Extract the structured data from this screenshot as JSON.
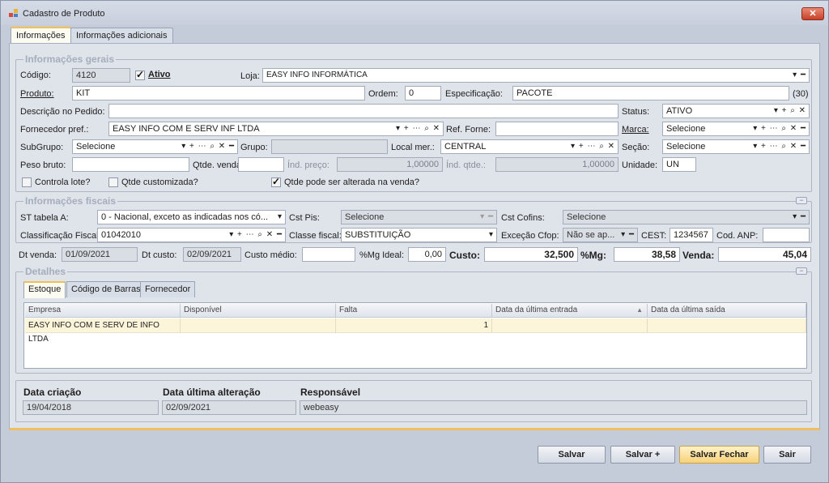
{
  "window": {
    "title": "Cadastro de Produto",
    "close": "✕"
  },
  "tabs": [
    "Informações",
    "Informações adicionais"
  ],
  "gerais": {
    "title": "Informações gerais",
    "codigo_label": "Código:",
    "codigo": "4120",
    "ativo_label": "Ativo",
    "loja_label": "Loja:",
    "loja": "EASY INFO INFORMÁTICA",
    "produto_label": "Produto:",
    "produto": "KIT",
    "ordem_label": "Ordem:",
    "ordem": "0",
    "especificacao_label": "Especificação:",
    "especificacao": "PACOTE",
    "especificacao_count": "(30)",
    "descricao_label": "Descrição no Pedido:",
    "descricao": "",
    "status_label": "Status:",
    "status": "ATIVO",
    "fornecedor_label": "Fornecedor pref.:",
    "fornecedor": "EASY INFO COM E SERV INF LTDA",
    "ref_forne_label": "Ref. Forne:",
    "ref_forne": "",
    "marca_label": "Marca:",
    "marca": "Selecione",
    "subgrupo_label": "SubGrupo:",
    "subgrupo": "Selecione",
    "grupo_label": "Grupo:",
    "grupo": "",
    "local_label": "Local mer.:",
    "local": "CENTRAL",
    "secao_label": "Seção:",
    "secao": "Selecione",
    "peso_label": "Peso bruto:",
    "peso": "",
    "qtde_venda_label": "Qtde. venda:",
    "qtde_venda": "",
    "ind_preco_label": "Índ. preço:",
    "ind_preco": "1,00000",
    "ind_qtde_label": "Índ. qtde.:",
    "ind_qtde": "1,00000",
    "unidade_label": "Unidade:",
    "unidade": "UN",
    "controla_lote": "Controla lote?",
    "qtde_customizada": "Qtde customizada?",
    "qtde_alterada": "Qtde pode ser alterada na venda?"
  },
  "fiscais": {
    "title": "Informações fiscais",
    "st_label": "ST tabela A:",
    "st": "0 - Nacional, exceto as indicadas nos có...",
    "cst_pis_label": "Cst Pis:",
    "cst_pis": "Selecione",
    "cst_cofins_label": "Cst Cofins:",
    "cst_cofins": "Selecione",
    "classif_label": "Classificação Fiscal:",
    "classif": "01042010",
    "classe_label": "Classe fiscal:",
    "classe": "SUBSTITUIÇÃO",
    "excecao_label": "Exceção Cfop:",
    "excecao": "Não se ap...",
    "cest_label": "CEST:",
    "cest": "1234567",
    "cod_anp_label": "Cod. ANP:",
    "cod_anp": ""
  },
  "precos": {
    "dt_venda_label": "Dt venda:",
    "dt_venda": "01/09/2021",
    "dt_custo_label": "Dt custo:",
    "dt_custo": "02/09/2021",
    "custo_medio_label": "Custo médio:",
    "custo_medio": "",
    "mg_ideal_label": "%Mg Ideal:",
    "mg_ideal": "0,00",
    "custo_label": "Custo:",
    "custo": "32,500",
    "mg_label": "%Mg:",
    "mg": "38,58",
    "venda_label": "Venda:",
    "venda": "45,04"
  },
  "detalhes": {
    "title": "Detalhes",
    "subtabs": [
      "Estoque",
      "Código de Barras",
      "Fornecedor"
    ],
    "columns": [
      "Empresa",
      "Disponível",
      "Falta",
      "Data da última entrada",
      "Data da última saída"
    ],
    "rows": [
      [
        "EASY INFO COM E SERV DE INFO LTDA",
        "",
        "1",
        "",
        ""
      ]
    ]
  },
  "footer": {
    "data_criacao_label": "Data criação",
    "data_criacao": "19/04/2018",
    "data_alteracao_label": "Data última alteração",
    "data_alteracao": "02/09/2021",
    "responsavel_label": "Responsável",
    "responsavel": "webeasy"
  },
  "buttons": {
    "salvar": "Salvar",
    "salvar_mais": "Salvar +",
    "salvar_fechar": "Salvar Fechar",
    "sair": "Sair"
  },
  "colors": {
    "accent": "#f2c055",
    "panel": "#dfe3ea",
    "window": "#c5ccd9",
    "row_highlight": "#fdf5da"
  }
}
